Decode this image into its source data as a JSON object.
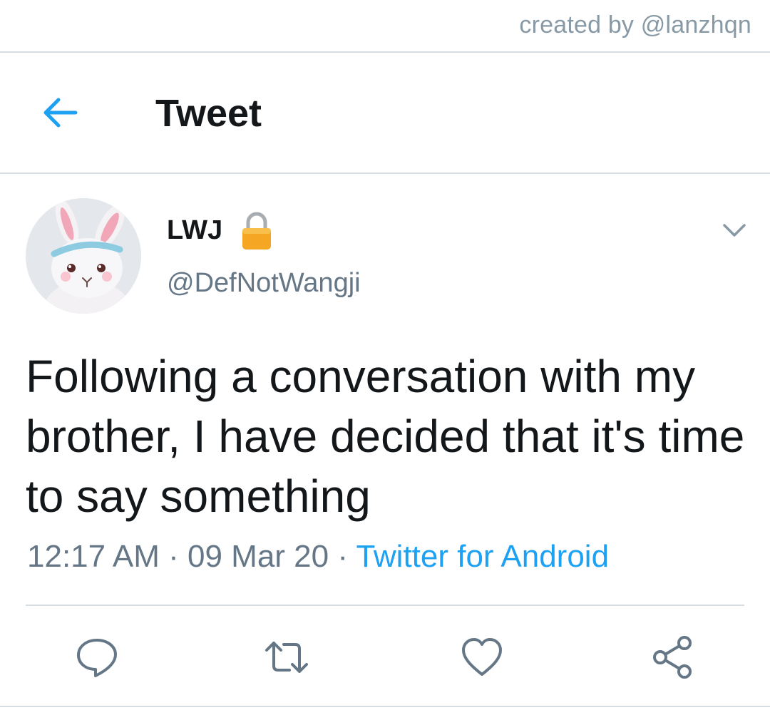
{
  "credit": "created by @lanzhqn",
  "header": {
    "title": "Tweet",
    "back_icon": "arrow-left-icon"
  },
  "tweet": {
    "display_name": "LWJ",
    "handle": "@DefNotWangji",
    "protected_icon": "lock-icon",
    "text": "Following a conversation with my brother, I have decided that it's time to say something",
    "time": "12:17 AM",
    "date": "09 Mar 20",
    "separator": " · ",
    "source": "Twitter for Android"
  },
  "actions": {
    "reply_icon": "reply-icon",
    "retweet_icon": "retweet-icon",
    "like_icon": "heart-icon",
    "share_icon": "share-icon"
  },
  "colors": {
    "accent": "#1da1f2",
    "secondary_text": "#657786",
    "divider": "#d8dde2",
    "lock": "#f5a623"
  }
}
